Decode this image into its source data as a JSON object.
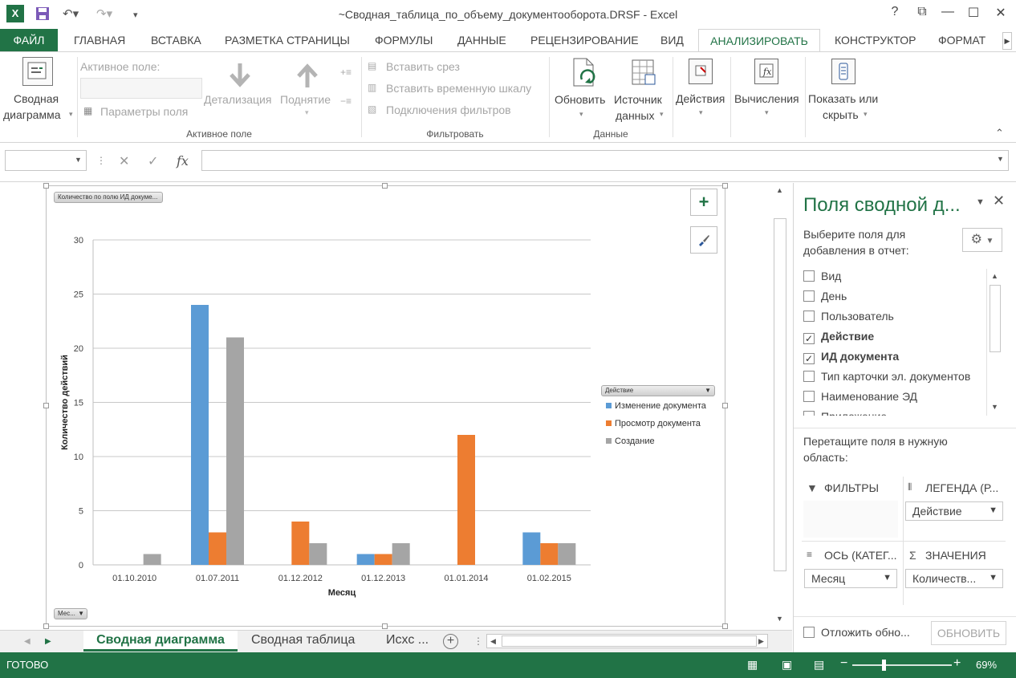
{
  "window": {
    "title": "~Сводная_таблица_по_объему_документооборота.DRSF - Excel",
    "help": "?",
    "restore_ribbon": "⧉",
    "minimize": "—",
    "maximize": "☐",
    "close": "✕"
  },
  "tabs": [
    {
      "label": "ФАЙЛ"
    },
    {
      "label": "ГЛАВНАЯ"
    },
    {
      "label": "ВСТАВКА"
    },
    {
      "label": "РАЗМЕТКА СТРАНИЦЫ"
    },
    {
      "label": "ФОРМУЛЫ"
    },
    {
      "label": "ДАННЫЕ"
    },
    {
      "label": "РЕЦЕНЗИРОВАНИЕ"
    },
    {
      "label": "ВИД"
    },
    {
      "label": "АНАЛИЗИРОВАТЬ"
    },
    {
      "label": "КОНСТРУКТОР"
    },
    {
      "label": "ФОРМАТ"
    }
  ],
  "ribbon": {
    "pivot_chart": {
      "line1": "Сводная",
      "line2": "диаграмма"
    },
    "active_field_label": "Активное поле:",
    "field_params": "Параметры поля",
    "drilldown": "Детализация",
    "drillup": "Поднятие",
    "group_active_field": "Активное поле",
    "insert_slicer": "Вставить срез",
    "insert_timeline": "Вставить временную шкалу",
    "filter_connections": "Подключения фильтров",
    "group_filter": "Фильтровать",
    "refresh": "Обновить",
    "source": {
      "line1": "Источник",
      "line2": "данных"
    },
    "group_data": "Данные",
    "actions": "Действия",
    "calculations": "Вычисления",
    "show_hide": {
      "line1": "Показать или",
      "line2": "скрыть"
    }
  },
  "formula_bar": {
    "cancel": "✕",
    "confirm": "✓",
    "fx": "fx",
    "value": ""
  },
  "chart": {
    "value_field_button": "Количество по полю ИД докуме...",
    "axis_field_button": "Мес...",
    "legend_field_button": "Действие",
    "plus_icon": "+",
    "brush_icon": "🖌"
  },
  "chart_data": {
    "type": "bar",
    "categories": [
      "01.10.2010",
      "01.07.2011",
      "01.12.2012",
      "01.12.2013",
      "01.01.2014",
      "01.02.2015"
    ],
    "series": [
      {
        "name": "Изменение документа",
        "color": "#5b9bd5",
        "values": [
          0,
          24,
          0,
          1,
          0,
          3
        ]
      },
      {
        "name": "Просмотр документа",
        "color": "#ed7d31",
        "values": [
          0,
          3,
          4,
          1,
          12,
          2
        ]
      },
      {
        "name": "Создание",
        "color": "#a5a5a5",
        "values": [
          1,
          21,
          2,
          2,
          0,
          2
        ]
      }
    ],
    "xlabel": "Месяц",
    "ylabel": "Количество действий",
    "ylim": [
      0,
      30
    ],
    "yticks": [
      0,
      5,
      10,
      15,
      20,
      25,
      30
    ],
    "grid": true,
    "legend": "right"
  },
  "pane": {
    "title": "Поля сводной д...",
    "subtitle1": "Выберите поля для",
    "subtitle2": "добавления в отчет:",
    "fields": [
      {
        "label": "Вид",
        "checked": false
      },
      {
        "label": "День",
        "checked": false
      },
      {
        "label": "Пользователь",
        "checked": false
      },
      {
        "label": "Действие",
        "checked": true
      },
      {
        "label": "ИД документа",
        "checked": true
      },
      {
        "label": "Тип карточки эл. документов",
        "checked": false
      },
      {
        "label": "Наименование ЭД",
        "checked": false
      },
      {
        "label": "Приложение",
        "checked": false
      }
    ],
    "drag_hint1": "Перетащите поля в нужную",
    "drag_hint2": "область:",
    "filters_label": "ФИЛЬТРЫ",
    "legend_label": "ЛЕГЕНДА (Р...",
    "legend_value": "Действие",
    "axis_label": "ОСЬ (КАТЕГ...",
    "axis_value": "Месяц",
    "values_label": "ЗНАЧЕНИЯ",
    "values_value": "Количеств...",
    "defer_label": "Отложить обно...",
    "update_button": "ОБНОВИТЬ"
  },
  "sheet_tabs": [
    {
      "label": "Сводная диаграмма",
      "active": true
    },
    {
      "label": "Сводная таблица",
      "active": false
    },
    {
      "label": "Исхс ...",
      "active": false
    }
  ],
  "status": {
    "ready": "ГОТОВО",
    "zoom": "69%"
  }
}
